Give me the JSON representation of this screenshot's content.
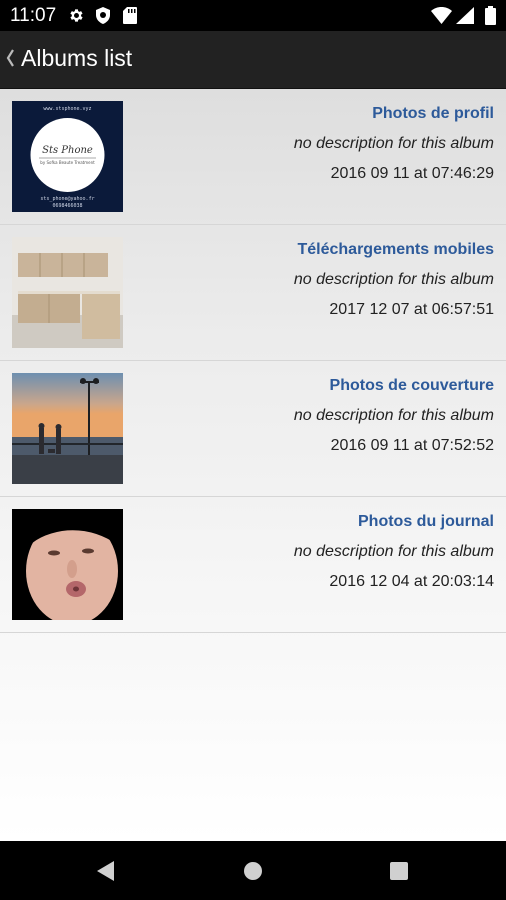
{
  "status_bar": {
    "time": "11:07"
  },
  "app_bar": {
    "title": "Albums list"
  },
  "albums": [
    {
      "name": "Photos de profil",
      "description": "no description for this album",
      "date": "2016 09 11 at 07:46:29"
    },
    {
      "name": "Téléchargements mobiles",
      "description": "no description for this album",
      "date": "2017 12 07 at 06:57:51"
    },
    {
      "name": "Photos de couverture",
      "description": "no description for this album",
      "date": "2016 09 11 at 07:52:52"
    },
    {
      "name": "Photos du journal",
      "description": "no description for this album",
      "date": "2016 12 04 at 20:03:14"
    }
  ],
  "thumbnail_1_text": {
    "website": "www.stsphone.vyz",
    "logo_script": "Sts Phone",
    "tagline": "by Sofka Beaute Treatment",
    "email": "sts_phone@yahoo.fr",
    "phone": "0698466038"
  },
  "colors": {
    "app_bar": "#222222",
    "album_title": "#2d5a9a"
  }
}
